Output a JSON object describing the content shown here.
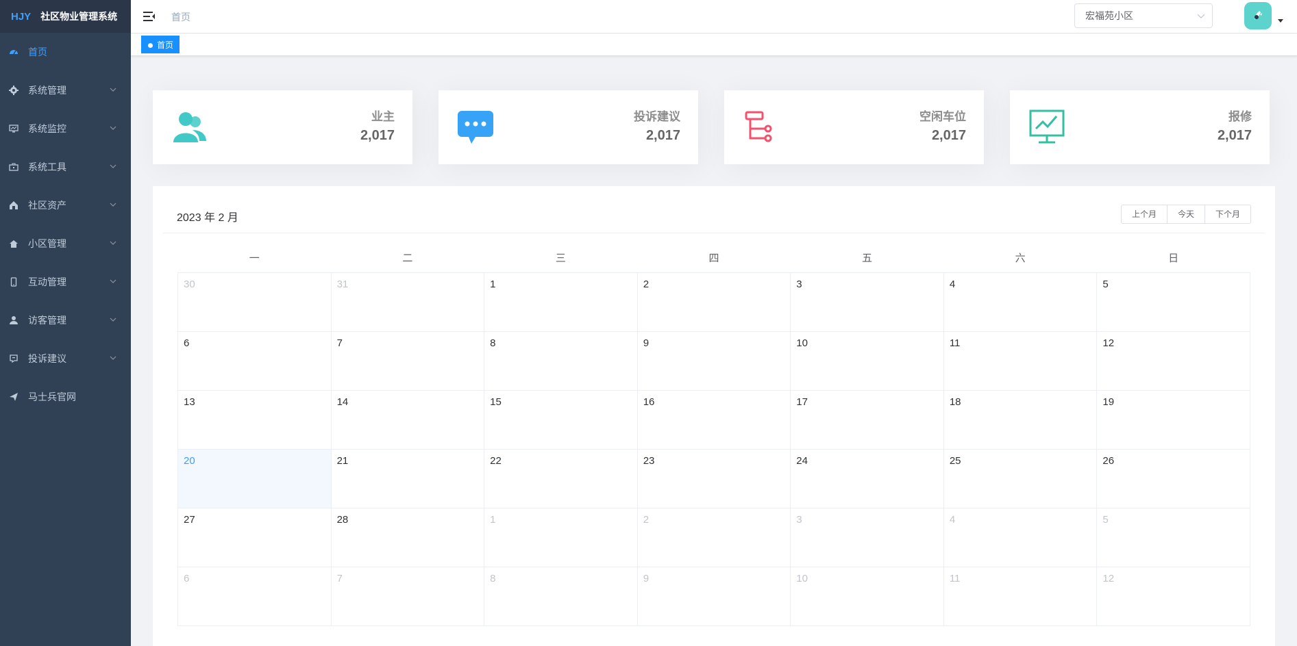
{
  "app": {
    "brand": "HJY",
    "title": "社区物业管理系统"
  },
  "sidebar": {
    "items": [
      {
        "label": "首页",
        "icon": "dashboard-icon",
        "active": true,
        "has_children": false
      },
      {
        "label": "系统管理",
        "icon": "gear-icon",
        "active": false,
        "has_children": true
      },
      {
        "label": "系统监控",
        "icon": "monitor-icon",
        "active": false,
        "has_children": true
      },
      {
        "label": "系统工具",
        "icon": "toolbox-icon",
        "active": false,
        "has_children": true
      },
      {
        "label": "社区资产",
        "icon": "house-icon",
        "active": false,
        "has_children": true
      },
      {
        "label": "小区管理",
        "icon": "home-icon",
        "active": false,
        "has_children": true
      },
      {
        "label": "互动管理",
        "icon": "phone-icon",
        "active": false,
        "has_children": true
      },
      {
        "label": "访客管理",
        "icon": "user-icon",
        "active": false,
        "has_children": true
      },
      {
        "label": "投诉建议",
        "icon": "message-icon",
        "active": false,
        "has_children": true
      },
      {
        "label": "马士兵官网",
        "icon": "paper-plane-icon",
        "active": false,
        "has_children": false
      }
    ]
  },
  "navbar": {
    "breadcrumb": "首页",
    "community_select": {
      "value": "宏福苑小区"
    }
  },
  "tags": {
    "active_tag": "首页"
  },
  "stats": [
    {
      "label": "业主",
      "value": "2,017",
      "icon": "people-icon",
      "color": "#40c9c6"
    },
    {
      "label": "投诉建议",
      "value": "2,017",
      "icon": "message-bubble-icon",
      "color": "#36a3f7"
    },
    {
      "label": "空闲车位",
      "value": "2,017",
      "icon": "tree-structure-icon",
      "color": "#f4516c"
    },
    {
      "label": "报修",
      "value": "2,017",
      "icon": "chart-board-icon",
      "color": "#34bfa3"
    }
  ],
  "calendar": {
    "title": "2023 年 2 月",
    "buttons": {
      "prev": "上个月",
      "today": "今天",
      "next": "下个月"
    },
    "weekdays": [
      "一",
      "二",
      "三",
      "四",
      "五",
      "六",
      "日"
    ],
    "weeks": [
      [
        "30",
        "31",
        "1",
        "2",
        "3",
        "4",
        "5"
      ],
      [
        "6",
        "7",
        "8",
        "9",
        "10",
        "11",
        "12"
      ],
      [
        "13",
        "14",
        "15",
        "16",
        "17",
        "18",
        "19"
      ],
      [
        "20",
        "21",
        "22",
        "23",
        "24",
        "25",
        "26"
      ],
      [
        "27",
        "28",
        "1",
        "2",
        "3",
        "4",
        "5"
      ],
      [
        "6",
        "7",
        "8",
        "9",
        "10",
        "11",
        "12"
      ]
    ]
  }
}
